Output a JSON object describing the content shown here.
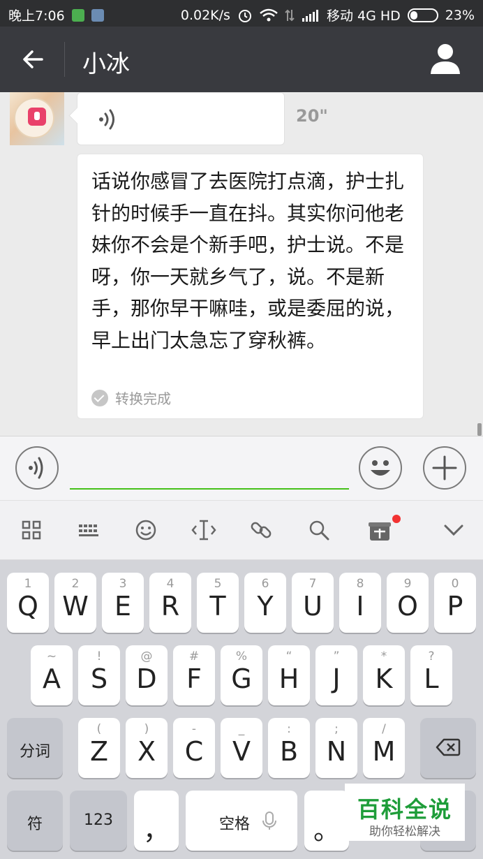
{
  "status_bar": {
    "time": "晚上7:06",
    "speed": "0.02K/s",
    "carrier": "移动 4G HD",
    "battery": "23%"
  },
  "header": {
    "title": "小冰",
    "back_icon": "arrow-left-icon",
    "profile_icon": "person-icon"
  },
  "chat": {
    "voice_duration": "20\"",
    "transcript": "话说你感冒了去医院打点滴，护士扎针的时候手一直在抖。其实你问他老妹你不会是个新手吧，护士说。不是呀，你一天就乡气了，说。不是新手，那你早干嘛哇，或是委屈的说，早上出门太急忘了穿秋裤。",
    "status": "转换完成"
  },
  "input": {
    "value": "",
    "accent_color": "#45c01a"
  },
  "keyboard_toolbar": {
    "icons": [
      "grid-icon",
      "keyboard-icon",
      "smiley-icon",
      "cursor-icon",
      "link-icon",
      "search-icon",
      "gift-icon",
      "chevron-down-icon"
    ]
  },
  "keyboard": {
    "row1": [
      {
        "hint": "1",
        "key": "Q"
      },
      {
        "hint": "2",
        "key": "W"
      },
      {
        "hint": "3",
        "key": "E"
      },
      {
        "hint": "4",
        "key": "R"
      },
      {
        "hint": "5",
        "key": "T"
      },
      {
        "hint": "6",
        "key": "Y"
      },
      {
        "hint": "7",
        "key": "U"
      },
      {
        "hint": "8",
        "key": "I"
      },
      {
        "hint": "9",
        "key": "O"
      },
      {
        "hint": "0",
        "key": "P"
      }
    ],
    "row2": [
      {
        "hint": "~",
        "key": "A"
      },
      {
        "hint": "!",
        "key": "S"
      },
      {
        "hint": "@",
        "key": "D"
      },
      {
        "hint": "#",
        "key": "F"
      },
      {
        "hint": "%",
        "key": "G"
      },
      {
        "hint": "“",
        "key": "H"
      },
      {
        "hint": "”",
        "key": "J"
      },
      {
        "hint": "*",
        "key": "K"
      },
      {
        "hint": "?",
        "key": "L"
      }
    ],
    "row3": [
      {
        "hint": "(",
        "key": "Z"
      },
      {
        "hint": ")",
        "key": "X"
      },
      {
        "hint": "-",
        "key": "C"
      },
      {
        "hint": "_",
        "key": "V"
      },
      {
        "hint": ":",
        "key": "B"
      },
      {
        "hint": ";",
        "key": "N"
      },
      {
        "hint": "/",
        "key": "M"
      }
    ],
    "segment_label": "分词",
    "symbol_label": "符",
    "number_label": "123",
    "comma_label": "，",
    "space_label": "空格",
    "period_label": "。"
  },
  "watermark": {
    "title": "百科全说",
    "subtitle": "助你轻松解决"
  }
}
